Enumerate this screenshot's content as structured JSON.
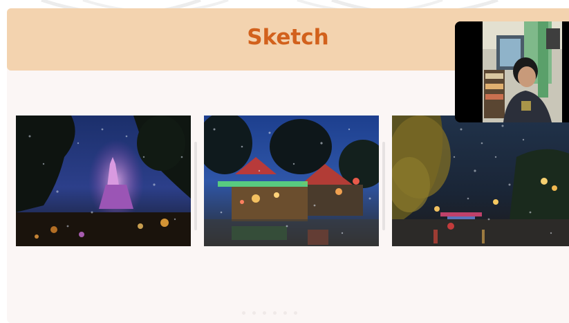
{
  "slide": {
    "title": "Sketch"
  },
  "photos": [
    {
      "subject": "temple-night-rain"
    },
    {
      "subject": "fairground-night-rain"
    },
    {
      "subject": "street-night-rain"
    }
  ],
  "webcam": {
    "subject": "presenter-video-feed"
  },
  "colors": {
    "title_bar": "#f3d3af",
    "title_text": "#d2611c",
    "slide_bg": "#fbf6f5"
  }
}
